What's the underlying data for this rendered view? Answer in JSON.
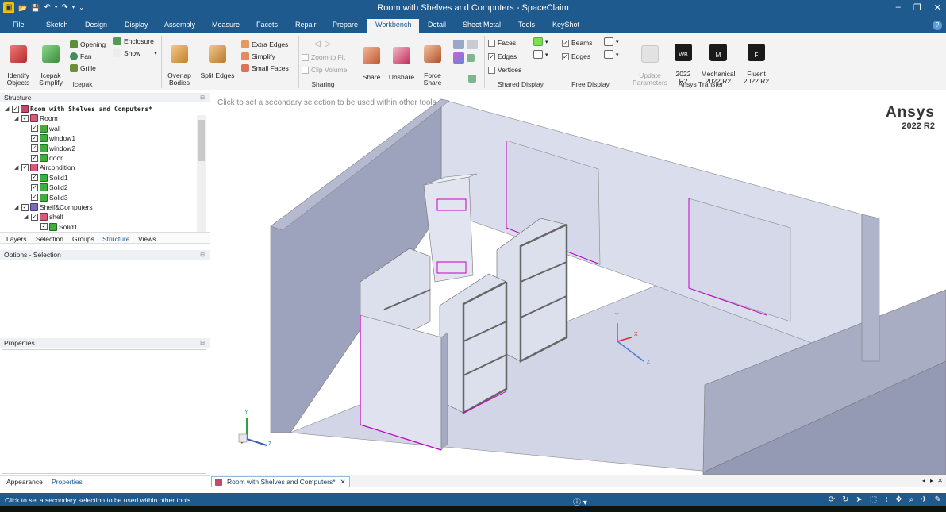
{
  "window": {
    "title": "Room with Shelves and Computers - SpaceClaim",
    "controls": [
      "–",
      "❐",
      "✕"
    ]
  },
  "quick_access": [
    "▣",
    "📂",
    "💾",
    "↶",
    "▾",
    "↷",
    "▾",
    "⌄"
  ],
  "tabs": [
    {
      "label": "File"
    },
    {
      "label": "Sketch"
    },
    {
      "label": "Design"
    },
    {
      "label": "Display"
    },
    {
      "label": "Assembly"
    },
    {
      "label": "Measure"
    },
    {
      "label": "Facets"
    },
    {
      "label": "Repair"
    },
    {
      "label": "Prepare"
    },
    {
      "label": "Workbench",
      "active": true
    },
    {
      "label": "Detail"
    },
    {
      "label": "Sheet Metal"
    },
    {
      "label": "Tools"
    },
    {
      "label": "KeyShot"
    }
  ],
  "help_label": "?",
  "ribbon": {
    "icepak": {
      "identify": "Identify\nObjects",
      "simplify": "Icepak\nSimplify",
      "opening": "Opening",
      "fan": "Fan",
      "grille": "Grille",
      "enclosure": "Enclosure",
      "show": "Show",
      "group": "Icepak"
    },
    "overlap": "Overlap\nBodies",
    "split_edges": "Split Edges",
    "extra_edges": "Extra Edges",
    "simplify2": "Simplify",
    "small_faces": "Small Faces",
    "sharing": {
      "zoom_fit": "Zoom to Fit",
      "clip_volume": "Clip Volume",
      "share": "Share",
      "unshare": "Unshare",
      "force_share": "Force\nShare",
      "group": "Sharing"
    },
    "shared_display": {
      "faces": "Faces",
      "edges": "Edges",
      "vertices": "Vertices",
      "group": "Shared Display"
    },
    "free_display": {
      "beams": "Beams",
      "edges": "Edges",
      "group": "Free Display"
    },
    "ansys": {
      "update": "Update\nParameters",
      "wb": "2022\nR2",
      "wb_badge": "WB",
      "mech": "Mechanical\n2022 R2",
      "mech_badge": "M",
      "fluent": "Fluent\n2022 R2",
      "fluent_badge": "F",
      "group": "Ansys Transfer"
    }
  },
  "structure": {
    "header": "Structure",
    "items": [
      {
        "label": "Room with Shelves and Computers*",
        "level": 0,
        "icon": "root",
        "expanded": true
      },
      {
        "label": "Room",
        "level": 1,
        "icon": "asm",
        "expanded": true
      },
      {
        "label": "wall",
        "level": 2,
        "icon": "green"
      },
      {
        "label": "window1",
        "level": 2,
        "icon": "green"
      },
      {
        "label": "window2",
        "level": 2,
        "icon": "green"
      },
      {
        "label": "door",
        "level": 2,
        "icon": "green"
      },
      {
        "label": "Aircondition",
        "level": 1,
        "icon": "asm",
        "expanded": true
      },
      {
        "label": "Solid1",
        "level": 2,
        "icon": "green"
      },
      {
        "label": "Solid2",
        "level": 2,
        "icon": "green"
      },
      {
        "label": "Solid3",
        "level": 2,
        "icon": "green"
      },
      {
        "label": "Shelf&Computers",
        "level": 1,
        "icon": "asm2",
        "expanded": true
      },
      {
        "label": "shelf",
        "level": 2,
        "icon": "asm",
        "expanded": true
      },
      {
        "label": "Solid1",
        "level": 3,
        "icon": "green"
      }
    ]
  },
  "panel_tabs": [
    "Layers",
    "Selection",
    "Groups",
    "Structure",
    "Views"
  ],
  "options_header": "Options - Selection",
  "properties_header": "Properties",
  "bottom_panel_tabs": [
    "Appearance",
    "Properties"
  ],
  "viewport": {
    "message": "Click to set a secondary selection to be used within other tools",
    "logo_brand": "Ansys",
    "logo_version": "2022 R2",
    "axis": {
      "x": "X",
      "y": "Y",
      "z": "Z"
    }
  },
  "document_tab": "Room with Shelves and Computers*",
  "status": {
    "message": "Click to set a secondary selection to be used within other tools"
  },
  "colors": {
    "title_bar": "#1e5a8e",
    "accent": "#1e5a8e",
    "edge_highlight": "#d100d1",
    "wall": "#a5a9c0"
  }
}
